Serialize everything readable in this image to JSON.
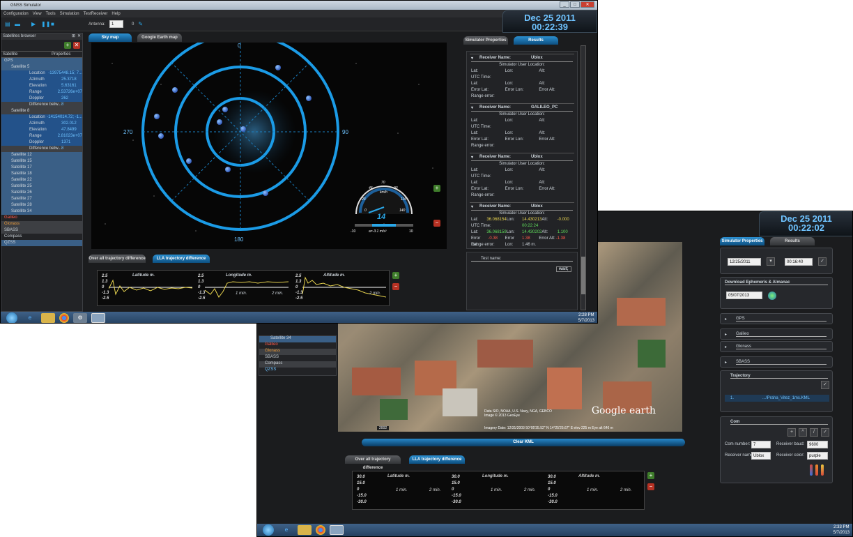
{
  "back_window": {
    "clock_date": "Dec 25 2011",
    "clock_time": "00:22:02",
    "tabs": {
      "props": "Simulator Properties",
      "results": "Results"
    },
    "date_value": "12/25/2011",
    "time_value": "00:16:40",
    "download_label": "Download Ephemeris & Almanac",
    "download_date": "05/07/2013",
    "sections": [
      "GPS",
      "Galileo",
      "Glonass",
      "SBASS"
    ],
    "trajectory_label": "Trajectory",
    "trajectory_row_num": "1.",
    "trajectory_file": "...\\Praha_Vitez_1ms.KML",
    "com_label": "Com",
    "com_number_label": "Com number:",
    "com_number_value": "7",
    "baud_label": "Receiver baud:",
    "baud_value": "9600",
    "receiver_name_label": "Receiver name",
    "receiver_name_value": "Ublox",
    "receiver_color_label": "Receiver color:",
    "receiver_color_value": "purple",
    "clear_kml": "Clear KML",
    "bottom_tabs": {
      "overall": "Over all trajectory difference",
      "lla": "LLA trajectory difference"
    },
    "graph_titles": [
      "Latitude m.",
      "Longitude m.",
      "Altitude m."
    ],
    "ticks": [
      "30.0",
      "15.0",
      "0",
      "-15.0",
      "-30.0"
    ],
    "time_ticks": [
      "1 min.",
      "2 min."
    ],
    "left_items": [
      "Satellite 34",
      "Galileo",
      "Glonass",
      "SBASS",
      "Compass",
      "QZSS"
    ],
    "map_credit": "Google earth",
    "map_year": "2002",
    "map_copyright": "Data SIO, NOAA, U.S. Navy, NGA, GEBCO",
    "map_copyright2": "Image © 2013 GeoEye",
    "map_coords": "Imagery Date: 12/31/2003  50°05'35.52\" N  14°25'25.67\" E  elev 225 m   Eye alt 646 m",
    "tray_time": "2:33 PM",
    "tray_date": "5/7/2013"
  },
  "front_window": {
    "title": "GNSS Simulator",
    "menu": [
      "Configuration",
      "View",
      "Tools",
      "Simulation",
      "TestReceiver",
      "Help"
    ],
    "antenna_label": "Antenna:",
    "antenna_value": "1",
    "antenna_num": "0",
    "clock_date": "Dec 25 2011",
    "clock_time": "00:22:39",
    "left_title": "Satellites browser",
    "col_satellite": "Satellite",
    "col_properties": "Properties",
    "tree": [
      {
        "k": "GPS",
        "v": "",
        "c": "blue",
        "i": 0
      },
      {
        "k": "Satellite 5",
        "v": "",
        "c": "blue",
        "i": 1
      },
      {
        "k": "Location",
        "v": "-13975448.15; 7...",
        "c": "sel",
        "i": 2
      },
      {
        "k": "Azimuth",
        "v": "25.3718",
        "c": "sel",
        "i": 2
      },
      {
        "k": "Elevation",
        "v": "5.63161",
        "c": "sel",
        "i": 2
      },
      {
        "k": "Range",
        "v": "2.53726e+07",
        "c": "sel",
        "i": 2
      },
      {
        "k": "Doppler",
        "v": "262",
        "c": "sel",
        "i": 2
      },
      {
        "k": "Difference betw...",
        "v": "8",
        "c": "grey",
        "i": 2
      },
      {
        "k": "Satellite 8",
        "v": "",
        "c": "grey",
        "i": 1
      },
      {
        "k": "Location",
        "v": "-14154014.72; -1...",
        "c": "sel",
        "i": 2
      },
      {
        "k": "Azimuth",
        "v": "302.012",
        "c": "sel",
        "i": 2
      },
      {
        "k": "Elevation",
        "v": "47.8499",
        "c": "sel",
        "i": 2
      },
      {
        "k": "Range",
        "v": "2.81023e+07",
        "c": "sel",
        "i": 2
      },
      {
        "k": "Doppler",
        "v": "1371",
        "c": "sel",
        "i": 2
      },
      {
        "k": "Difference betw...",
        "v": "8",
        "c": "grey",
        "i": 2
      },
      {
        "k": "Satellite 12",
        "v": "",
        "c": "blue",
        "i": 1
      },
      {
        "k": "Satellite 15",
        "v": "",
        "c": "blue",
        "i": 1
      },
      {
        "k": "Satellite 17",
        "v": "",
        "c": "blue",
        "i": 1
      },
      {
        "k": "Satellite 18",
        "v": "",
        "c": "blue",
        "i": 1
      },
      {
        "k": "Satellite 22",
        "v": "",
        "c": "blue",
        "i": 1
      },
      {
        "k": "Satellite 25",
        "v": "",
        "c": "blue",
        "i": 1
      },
      {
        "k": "Satellite 26",
        "v": "",
        "c": "blue",
        "i": 1
      },
      {
        "k": "Satellite 27",
        "v": "",
        "c": "blue",
        "i": 1
      },
      {
        "k": "Satellite 28",
        "v": "",
        "c": "blue",
        "i": 1
      },
      {
        "k": "Satellite 34",
        "v": "",
        "c": "blue",
        "i": 1
      },
      {
        "k": "Galileo",
        "v": "",
        "c": "red",
        "i": 0
      },
      {
        "k": "Glonass",
        "v": "",
        "c": "orange",
        "i": 0
      },
      {
        "k": "SBASS",
        "v": "",
        "c": "white",
        "i": 0
      },
      {
        "k": "Compass",
        "v": "",
        "c": "white",
        "i": 0
      },
      {
        "k": "QZSS",
        "v": "",
        "c": "blue",
        "i": 0
      }
    ],
    "tabs": {
      "sky": "Sky map",
      "google": "Google Earth map"
    },
    "compass": {
      "n": "0",
      "e": "90",
      "s": "180",
      "w": "270"
    },
    "speedo": {
      "value": "14",
      "unit": "km/h",
      "accel": "a=-3.1 m/s²",
      "scale": [
        "0",
        "23",
        "46",
        "70",
        "93",
        "116",
        "140"
      ],
      "min": "-10",
      "max": "10"
    },
    "bottom_tabs": {
      "overall": "Over all trajectory difference",
      "lla": "LLA trajectory difference"
    },
    "graph_titles": [
      "Latitude m.",
      "Longitude m.",
      "Altitude m."
    ],
    "ticks": [
      "2.5",
      "1.3",
      "0",
      "-1.3",
      "-2.5"
    ],
    "time_ticks": [
      "1 min.",
      "2 min."
    ],
    "right_tabs": {
      "props": "Simulator Properties",
      "results": "Results"
    },
    "labels": {
      "rx": "Receiver Name:",
      "loc": "Simulator User Location:",
      "lat": "Lat:",
      "lon": "Lon:",
      "alt": "Alt:",
      "utc": "UTC Time:",
      "elat": "Error Lat:",
      "elon": "Error Lon:",
      "ealt": "Error Alt:",
      "range": "Range error:",
      "test": "Test name:",
      "wait": "wait;"
    },
    "receivers": [
      "Ublox",
      "GALILEO_PC",
      "Ublox",
      "Ublox"
    ],
    "last": {
      "lat": "36.068154",
      "lon": "14.430213",
      "alt": "-0.000",
      "utc": "00:22:24",
      "lat2": "36.068159",
      "lon2": "14.430202",
      "alt2": "1.100",
      "elat": "-0.38",
      "elon": "1.38",
      "ealt": "-1.38",
      "range": "1.46 m."
    },
    "tray_time": "2:28 PM",
    "tray_date": "5/7/2013"
  }
}
